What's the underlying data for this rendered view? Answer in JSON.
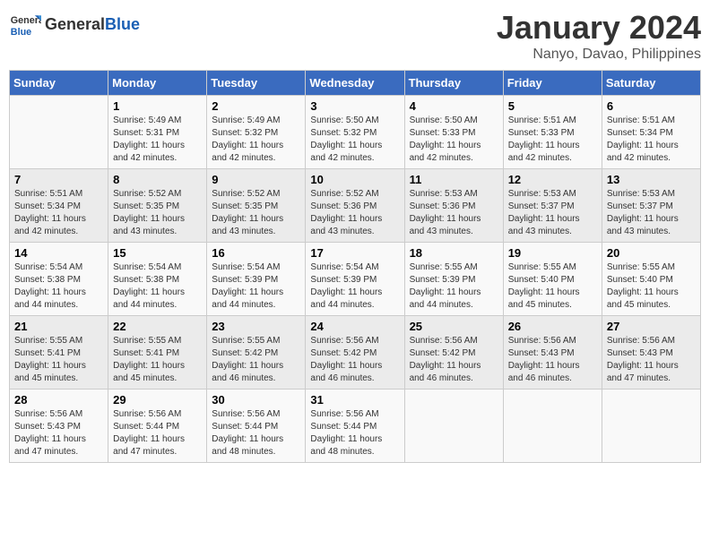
{
  "header": {
    "logo_general": "General",
    "logo_blue": "Blue",
    "month": "January 2024",
    "location": "Nanyo, Davao, Philippines"
  },
  "days_of_week": [
    "Sunday",
    "Monday",
    "Tuesday",
    "Wednesday",
    "Thursday",
    "Friday",
    "Saturday"
  ],
  "weeks": [
    [
      {
        "day": "",
        "sunrise": "",
        "sunset": "",
        "daylight": ""
      },
      {
        "day": "1",
        "sunrise": "Sunrise: 5:49 AM",
        "sunset": "Sunset: 5:31 PM",
        "daylight": "Daylight: 11 hours and 42 minutes."
      },
      {
        "day": "2",
        "sunrise": "Sunrise: 5:49 AM",
        "sunset": "Sunset: 5:32 PM",
        "daylight": "Daylight: 11 hours and 42 minutes."
      },
      {
        "day": "3",
        "sunrise": "Sunrise: 5:50 AM",
        "sunset": "Sunset: 5:32 PM",
        "daylight": "Daylight: 11 hours and 42 minutes."
      },
      {
        "day": "4",
        "sunrise": "Sunrise: 5:50 AM",
        "sunset": "Sunset: 5:33 PM",
        "daylight": "Daylight: 11 hours and 42 minutes."
      },
      {
        "day": "5",
        "sunrise": "Sunrise: 5:51 AM",
        "sunset": "Sunset: 5:33 PM",
        "daylight": "Daylight: 11 hours and 42 minutes."
      },
      {
        "day": "6",
        "sunrise": "Sunrise: 5:51 AM",
        "sunset": "Sunset: 5:34 PM",
        "daylight": "Daylight: 11 hours and 42 minutes."
      }
    ],
    [
      {
        "day": "7",
        "sunrise": "Sunrise: 5:51 AM",
        "sunset": "Sunset: 5:34 PM",
        "daylight": "Daylight: 11 hours and 42 minutes."
      },
      {
        "day": "8",
        "sunrise": "Sunrise: 5:52 AM",
        "sunset": "Sunset: 5:35 PM",
        "daylight": "Daylight: 11 hours and 43 minutes."
      },
      {
        "day": "9",
        "sunrise": "Sunrise: 5:52 AM",
        "sunset": "Sunset: 5:35 PM",
        "daylight": "Daylight: 11 hours and 43 minutes."
      },
      {
        "day": "10",
        "sunrise": "Sunrise: 5:52 AM",
        "sunset": "Sunset: 5:36 PM",
        "daylight": "Daylight: 11 hours and 43 minutes."
      },
      {
        "day": "11",
        "sunrise": "Sunrise: 5:53 AM",
        "sunset": "Sunset: 5:36 PM",
        "daylight": "Daylight: 11 hours and 43 minutes."
      },
      {
        "day": "12",
        "sunrise": "Sunrise: 5:53 AM",
        "sunset": "Sunset: 5:37 PM",
        "daylight": "Daylight: 11 hours and 43 minutes."
      },
      {
        "day": "13",
        "sunrise": "Sunrise: 5:53 AM",
        "sunset": "Sunset: 5:37 PM",
        "daylight": "Daylight: 11 hours and 43 minutes."
      }
    ],
    [
      {
        "day": "14",
        "sunrise": "Sunrise: 5:54 AM",
        "sunset": "Sunset: 5:38 PM",
        "daylight": "Daylight: 11 hours and 44 minutes."
      },
      {
        "day": "15",
        "sunrise": "Sunrise: 5:54 AM",
        "sunset": "Sunset: 5:38 PM",
        "daylight": "Daylight: 11 hours and 44 minutes."
      },
      {
        "day": "16",
        "sunrise": "Sunrise: 5:54 AM",
        "sunset": "Sunset: 5:39 PM",
        "daylight": "Daylight: 11 hours and 44 minutes."
      },
      {
        "day": "17",
        "sunrise": "Sunrise: 5:54 AM",
        "sunset": "Sunset: 5:39 PM",
        "daylight": "Daylight: 11 hours and 44 minutes."
      },
      {
        "day": "18",
        "sunrise": "Sunrise: 5:55 AM",
        "sunset": "Sunset: 5:39 PM",
        "daylight": "Daylight: 11 hours and 44 minutes."
      },
      {
        "day": "19",
        "sunrise": "Sunrise: 5:55 AM",
        "sunset": "Sunset: 5:40 PM",
        "daylight": "Daylight: 11 hours and 45 minutes."
      },
      {
        "day": "20",
        "sunrise": "Sunrise: 5:55 AM",
        "sunset": "Sunset: 5:40 PM",
        "daylight": "Daylight: 11 hours and 45 minutes."
      }
    ],
    [
      {
        "day": "21",
        "sunrise": "Sunrise: 5:55 AM",
        "sunset": "Sunset: 5:41 PM",
        "daylight": "Daylight: 11 hours and 45 minutes."
      },
      {
        "day": "22",
        "sunrise": "Sunrise: 5:55 AM",
        "sunset": "Sunset: 5:41 PM",
        "daylight": "Daylight: 11 hours and 45 minutes."
      },
      {
        "day": "23",
        "sunrise": "Sunrise: 5:55 AM",
        "sunset": "Sunset: 5:42 PM",
        "daylight": "Daylight: 11 hours and 46 minutes."
      },
      {
        "day": "24",
        "sunrise": "Sunrise: 5:56 AM",
        "sunset": "Sunset: 5:42 PM",
        "daylight": "Daylight: 11 hours and 46 minutes."
      },
      {
        "day": "25",
        "sunrise": "Sunrise: 5:56 AM",
        "sunset": "Sunset: 5:42 PM",
        "daylight": "Daylight: 11 hours and 46 minutes."
      },
      {
        "day": "26",
        "sunrise": "Sunrise: 5:56 AM",
        "sunset": "Sunset: 5:43 PM",
        "daylight": "Daylight: 11 hours and 46 minutes."
      },
      {
        "day": "27",
        "sunrise": "Sunrise: 5:56 AM",
        "sunset": "Sunset: 5:43 PM",
        "daylight": "Daylight: 11 hours and 47 minutes."
      }
    ],
    [
      {
        "day": "28",
        "sunrise": "Sunrise: 5:56 AM",
        "sunset": "Sunset: 5:43 PM",
        "daylight": "Daylight: 11 hours and 47 minutes."
      },
      {
        "day": "29",
        "sunrise": "Sunrise: 5:56 AM",
        "sunset": "Sunset: 5:44 PM",
        "daylight": "Daylight: 11 hours and 47 minutes."
      },
      {
        "day": "30",
        "sunrise": "Sunrise: 5:56 AM",
        "sunset": "Sunset: 5:44 PM",
        "daylight": "Daylight: 11 hours and 48 minutes."
      },
      {
        "day": "31",
        "sunrise": "Sunrise: 5:56 AM",
        "sunset": "Sunset: 5:44 PM",
        "daylight": "Daylight: 11 hours and 48 minutes."
      },
      {
        "day": "",
        "sunrise": "",
        "sunset": "",
        "daylight": ""
      },
      {
        "day": "",
        "sunrise": "",
        "sunset": "",
        "daylight": ""
      },
      {
        "day": "",
        "sunrise": "",
        "sunset": "",
        "daylight": ""
      }
    ]
  ]
}
